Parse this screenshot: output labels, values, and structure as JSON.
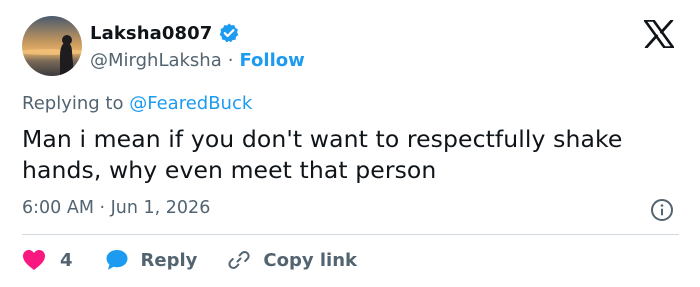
{
  "author": {
    "display_name": "Laksha0807",
    "handle": "@MirghLaksha",
    "separator": "·",
    "follow_label": "Follow",
    "verified": true
  },
  "brand": {
    "logo": "x-logo-icon"
  },
  "reply_context": {
    "prefix": "Replying to",
    "mention": "@FearedBuck"
  },
  "tweet": {
    "text": "Man i mean if you don't want to respectfully shake hands, why even meet that person"
  },
  "meta": {
    "timestamp": "6:00 AM · Jun 1, 2026"
  },
  "actions": {
    "like_count": "4",
    "reply_label": "Reply",
    "copy_label": "Copy link"
  },
  "colors": {
    "accent": "#1d9bf0",
    "like": "#f91880",
    "muted": "#536471",
    "text": "#0f1419",
    "divider": "#cfd9de"
  }
}
